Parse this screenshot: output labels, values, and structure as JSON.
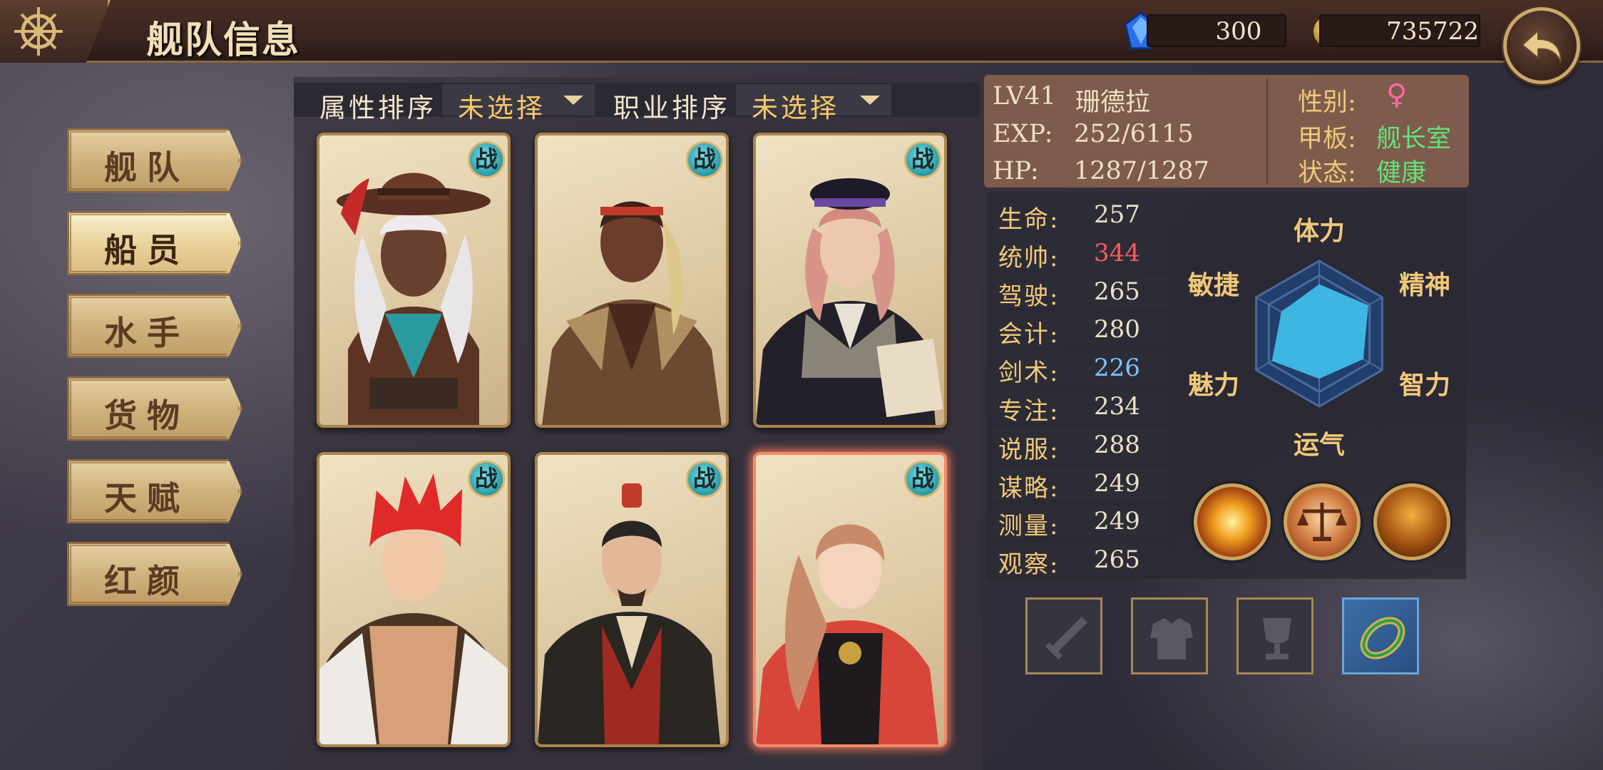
{
  "header": {
    "title": "舰队信息",
    "gems": "300",
    "coins": "735722"
  },
  "menu": [
    {
      "label": "舰队",
      "active": false
    },
    {
      "label": "船员",
      "active": true
    },
    {
      "label": "水手",
      "active": false
    },
    {
      "label": "货物",
      "active": false
    },
    {
      "label": "天赋",
      "active": false
    },
    {
      "label": "红颜",
      "active": false
    }
  ],
  "sort": {
    "attr_label": "属性排序",
    "attr_value": "未选择",
    "job_label": "职业排序",
    "job_value": "未选择"
  },
  "cards": [
    {
      "badge": "战"
    },
    {
      "badge": "战"
    },
    {
      "badge": "战"
    },
    {
      "badge": "战"
    },
    {
      "badge": "战"
    },
    {
      "badge": "战"
    }
  ],
  "info": {
    "level": "LV41",
    "name": "珊德拉",
    "exp_label": "EXP:",
    "exp": "252/6115",
    "hp_label": "HP:",
    "hp": "1287/1287",
    "gender_label": "性别:",
    "gender": "♀",
    "deck_label": "甲板:",
    "deck": "舰长室",
    "status_label": "状态:",
    "status": "健康"
  },
  "stats": [
    {
      "label": "生命:",
      "value": "257"
    },
    {
      "label": "统帅:",
      "value": "344",
      "color": "#ff5a5a"
    },
    {
      "label": "驾驶:",
      "value": "265"
    },
    {
      "label": "会计:",
      "value": "280"
    },
    {
      "label": "剑术:",
      "value": "226",
      "color": "#7fc2ff"
    },
    {
      "label": "专注:",
      "value": "234"
    },
    {
      "label": "说服:",
      "value": "288"
    },
    {
      "label": "谋略:",
      "value": "249"
    },
    {
      "label": "测量:",
      "value": "249"
    },
    {
      "label": "观察:",
      "value": "265"
    }
  ],
  "radar": {
    "labels": [
      "体力",
      "精神",
      "智力",
      "运气",
      "魅力",
      "敏捷"
    ],
    "values": [
      0.68,
      0.78,
      0.7,
      0.62,
      0.75,
      0.6
    ]
  },
  "colors": {
    "accent": "#f6c869",
    "green": "#63e37a",
    "gender": "#ff6aa0"
  }
}
